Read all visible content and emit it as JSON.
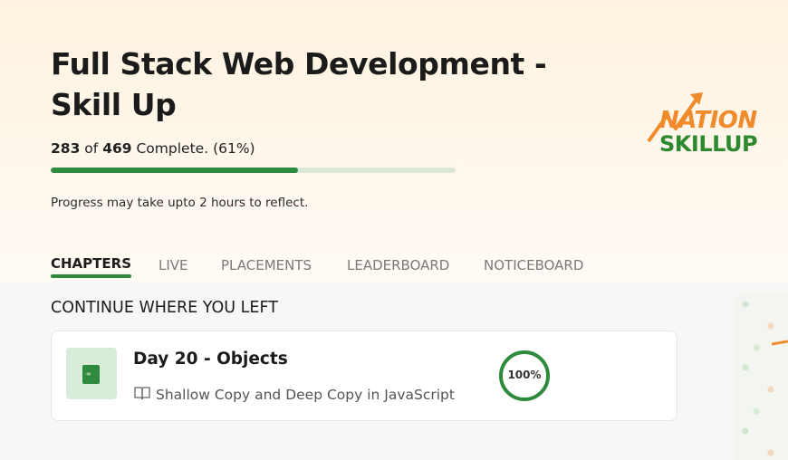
{
  "course": {
    "title": "Full Stack Web Development - Skill Up",
    "completed": "283",
    "total": "469",
    "complete_label": "Complete.",
    "percent_label": "(61%)",
    "progress_fraction": 0.61,
    "reflect_note": "Progress may take upto 2 hours to reflect."
  },
  "logo": {
    "line1": "NATION",
    "line2": "SKILLUP"
  },
  "tabs": [
    {
      "label": "CHAPTERS",
      "active": true
    },
    {
      "label": "LIVE",
      "active": false
    },
    {
      "label": "PLACEMENTS",
      "active": false
    },
    {
      "label": "LEADERBOARD",
      "active": false
    },
    {
      "label": "NOTICEBOARD",
      "active": false
    }
  ],
  "continue_section": {
    "title": "CONTINUE WHERE YOU LEFT",
    "card": {
      "chapter_title": "Day 20 - Objects",
      "lesson_title": "Shallow Copy and Deep Copy in JavaScript",
      "progress_label": "100%",
      "progress_fraction": 1.0
    }
  },
  "colors": {
    "accent": "#2e8b3e",
    "track": "#dbe8d5",
    "logo_orange": "#f08a2a",
    "logo_green": "#2d8a2f"
  },
  "icons": {
    "lesson": "open-book-icon",
    "thumbnail": "book-icon",
    "logo_arrow": "rising-arrow-icon"
  }
}
